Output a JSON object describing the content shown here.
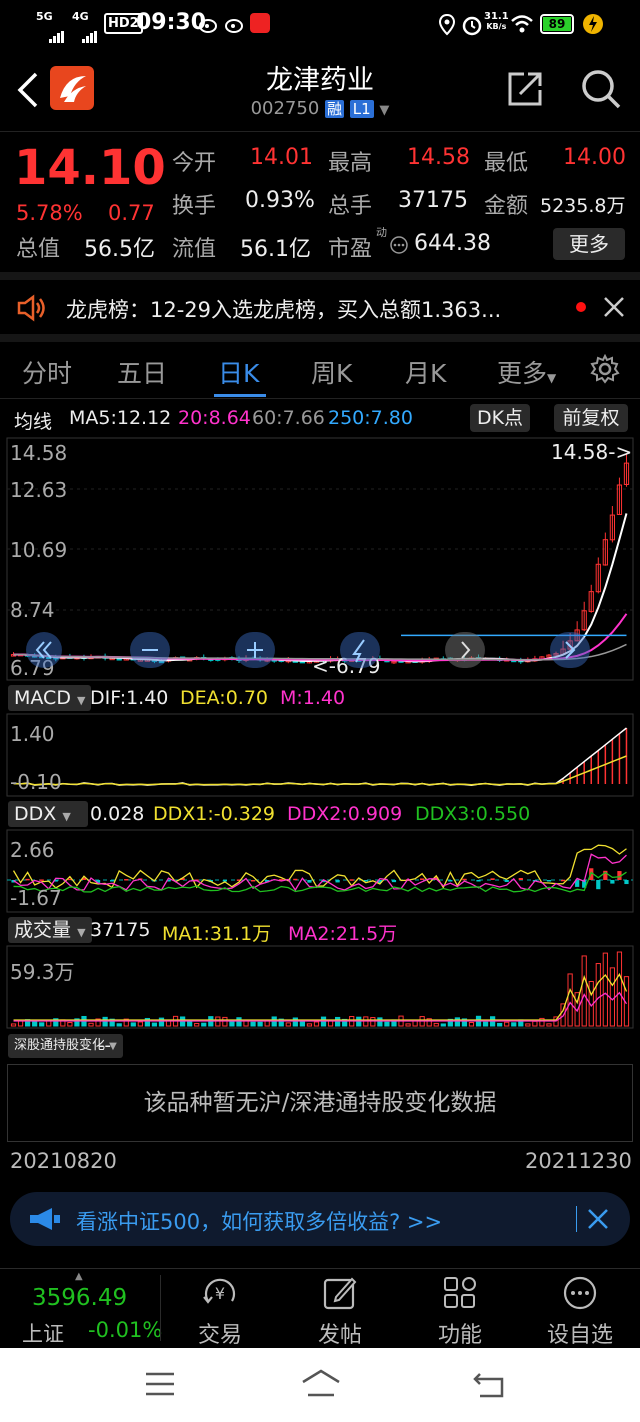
{
  "status_bar": {
    "net1": "5G",
    "net2": "4G",
    "hd": "HD2",
    "time": "09:30",
    "speed": "31.1",
    "speed_unit": "KB/s",
    "battery": "89"
  },
  "header": {
    "name": "龙津药业",
    "code": "002750",
    "badge_rong": "融",
    "badge_level": "L1"
  },
  "quote": {
    "price": "14.10",
    "change_pct": "5.78%",
    "change": "0.77",
    "open_label": "今开",
    "open": "14.01",
    "high_label": "最高",
    "high": "14.58",
    "low_label": "最低",
    "low": "14.00",
    "turnover_label": "换手",
    "turnover": "0.93%",
    "volume_label": "总手",
    "volume": "37175",
    "amount_label": "金额",
    "amount": "5235.8万",
    "total_cap_label": "总值",
    "total_cap": "56.5亿",
    "float_cap_label": "流值",
    "float_cap": "56.1亿",
    "pe_label": "市盈",
    "pe_sup": "动",
    "pe": "644.38",
    "more": "更多"
  },
  "news": {
    "text": "龙虎榜：12-29入选龙虎榜，买入总额1.363..."
  },
  "tabs": [
    "分时",
    "五日",
    "日K",
    "周K",
    "月K",
    "更多"
  ],
  "active_tab": "日K",
  "ma_bar": {
    "label": "均线",
    "ma5": "MA5:12.12",
    "ma20": "20:8.64",
    "ma60": "60:7.66",
    "ma250": "250:7.80",
    "dk_button": "DK点",
    "adjust_button": "前复权"
  },
  "kline": {
    "y_ticks": [
      "14.58",
      "12.63",
      "10.69",
      "8.74",
      "6.79"
    ],
    "max_marker": "14.58->",
    "min_marker": "<-6.79"
  },
  "macd": {
    "name": "MACD",
    "dif": "DIF:1.40",
    "dea": "DEA:0.70",
    "m": "M:1.40",
    "top": "1.40",
    "bottom": "-0.10"
  },
  "ddx": {
    "name": "DDX",
    "value": "0.028",
    "ddx1": "DDX1:-0.329",
    "ddx2": "DDX2:0.909",
    "ddx3": "DDX3:0.550",
    "top": "2.66",
    "bottom": "-1.67"
  },
  "vol": {
    "name": "成交量",
    "value": "37175",
    "ma1": "MA1:31.1万",
    "ma2": "MA2:21.5万",
    "top": "59.3万"
  },
  "hk": {
    "name": "深股通持股变化",
    "dash": "--",
    "empty": "该品种暂无沪/深港通持股变化数据"
  },
  "dates": {
    "start": "20210820",
    "end": "20211230"
  },
  "promo": {
    "text": "看涨中证500，如何获取多倍收益? >>"
  },
  "bottom_nav": {
    "index_value": "3596.49",
    "index_name": "上证",
    "index_change": "-0.01%",
    "items": [
      "交易",
      "发帖",
      "功能",
      "设自选"
    ]
  },
  "colors": {
    "up": "#ff3333",
    "down": "#00c8c8",
    "ma5": "#ffffff",
    "ma20": "#ff33cc",
    "ma60": "#999999",
    "ma250": "#33aaff"
  }
}
